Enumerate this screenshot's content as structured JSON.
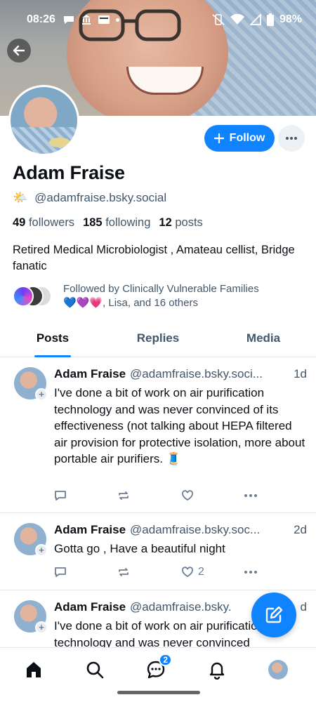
{
  "status_bar": {
    "time": "08:26",
    "battery": "98%"
  },
  "profile": {
    "display_name": "Adam Fraise",
    "handle": "@adamfraise.bsky.social",
    "emoji": "🌤️",
    "followers_count": "49",
    "followers_label": "followers",
    "following_count": "185",
    "following_label": "following",
    "posts_count": "12",
    "posts_label": "posts",
    "bio": "Retired Medical Microbiologist , Amateau cellist, Bridge fanatic",
    "followed_by_line1": "Followed by Clinically Vulnerable Families",
    "followed_by_line2": "💙💜💗, Lisa, and 16 others",
    "follow_button": "Follow"
  },
  "tabs": [
    {
      "label": "Posts",
      "active": true
    },
    {
      "label": "Replies",
      "active": false
    },
    {
      "label": "Media",
      "active": false
    }
  ],
  "posts": [
    {
      "author": "Adam Fraise",
      "handle": "@adamfraise.bsky.soci...",
      "time": "1d",
      "text": "I've done a bit of work on air purification technology and was never convinced of its effectiveness (not talking about HEPA filtered air provision for protective isolation, more about portable air purifiers. 🧵",
      "likes": ""
    },
    {
      "author": "Adam Fraise",
      "handle": "@adamfraise.bsky.soc...",
      "time": "2d",
      "text": "Gotta go , Have a beautiful night",
      "likes": "2"
    },
    {
      "author": "Adam Fraise",
      "handle": "@adamfraise.bsky.",
      "time": "d",
      "text": "I've done a bit of work on air purification technology and was never convinced",
      "likes": ""
    }
  ],
  "nav": {
    "chat_badge": "2"
  },
  "colors": {
    "accent": "#1083fe",
    "muted": "#42576c"
  }
}
